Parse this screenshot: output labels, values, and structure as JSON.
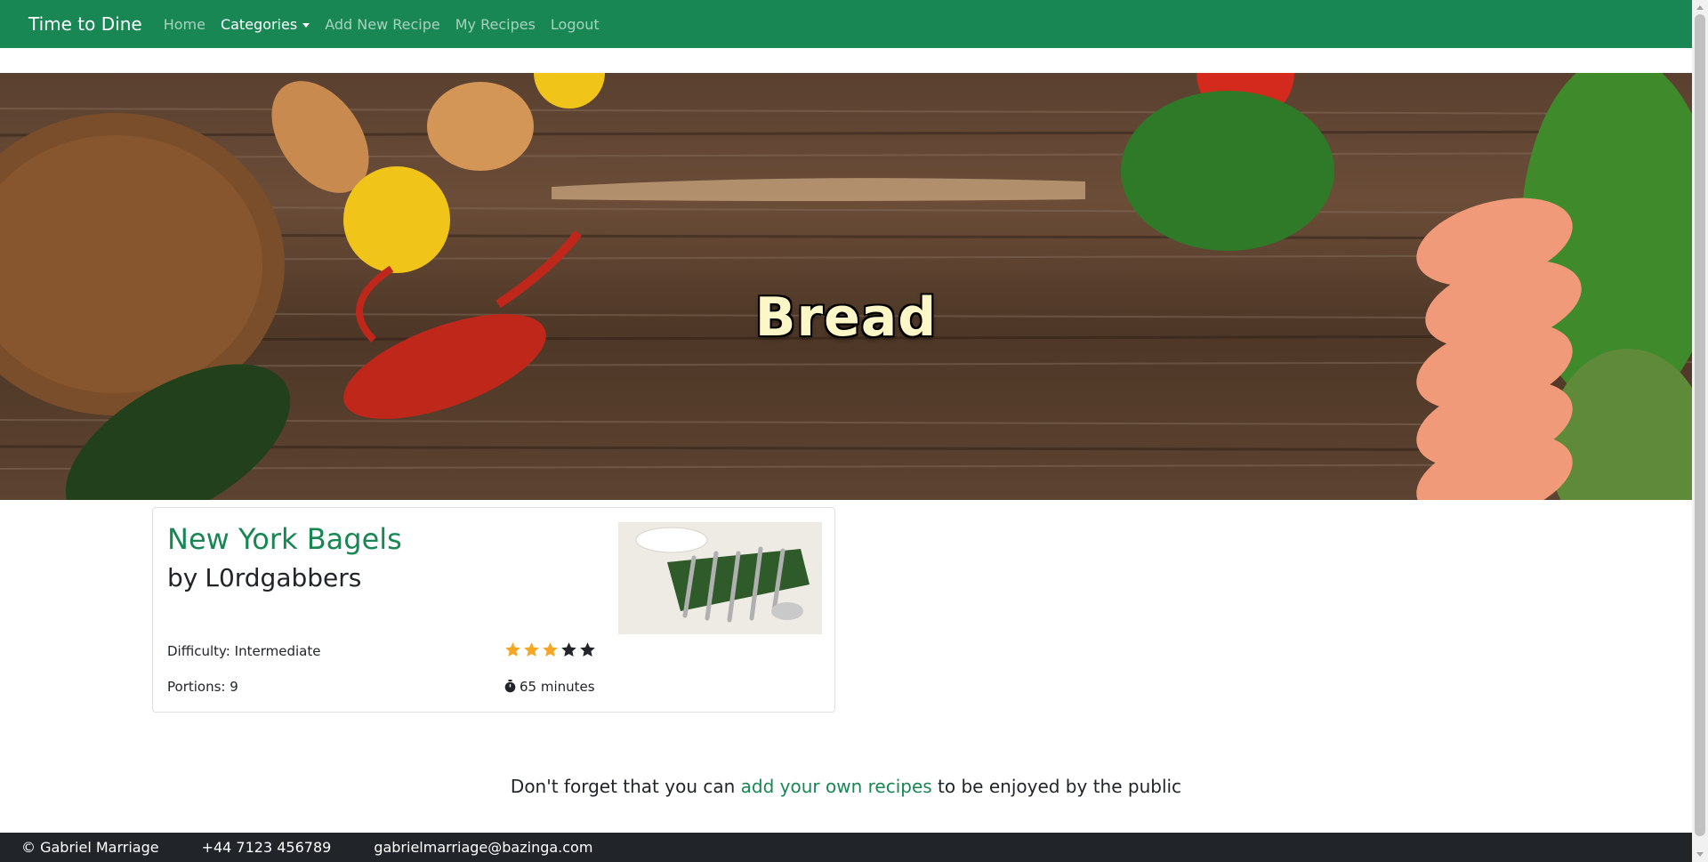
{
  "navbar": {
    "brand": "Time to Dine",
    "items": [
      {
        "label": "Home"
      },
      {
        "label": "Categories"
      },
      {
        "label": "Add New Recipe"
      },
      {
        "label": "My Recipes"
      },
      {
        "label": "Logout"
      }
    ]
  },
  "hero": {
    "title": "Bread"
  },
  "recipe": {
    "title": "New York Bagels",
    "author_prefix": "by",
    "author": "L0rdgabbers",
    "difficulty_label": "Difficulty:",
    "difficulty": "Intermediate",
    "portions_label": "Portions:",
    "portions": "9",
    "rating": 3,
    "rating_max": 5,
    "time": "65 minutes"
  },
  "footer_note": {
    "before": "Don't forget that you can",
    "link": "add your own recipes",
    "after": "to be enjoyed by the public"
  },
  "footer": {
    "copyright": "© Gabriel Marriage",
    "phone": "+44 7123 456789",
    "email": "gabrielmarriage@bazinga.com"
  },
  "colors": {
    "brand_green": "#198754",
    "star_filled": "#f5a623",
    "star_empty": "#212529",
    "footer_bg": "#212529"
  }
}
